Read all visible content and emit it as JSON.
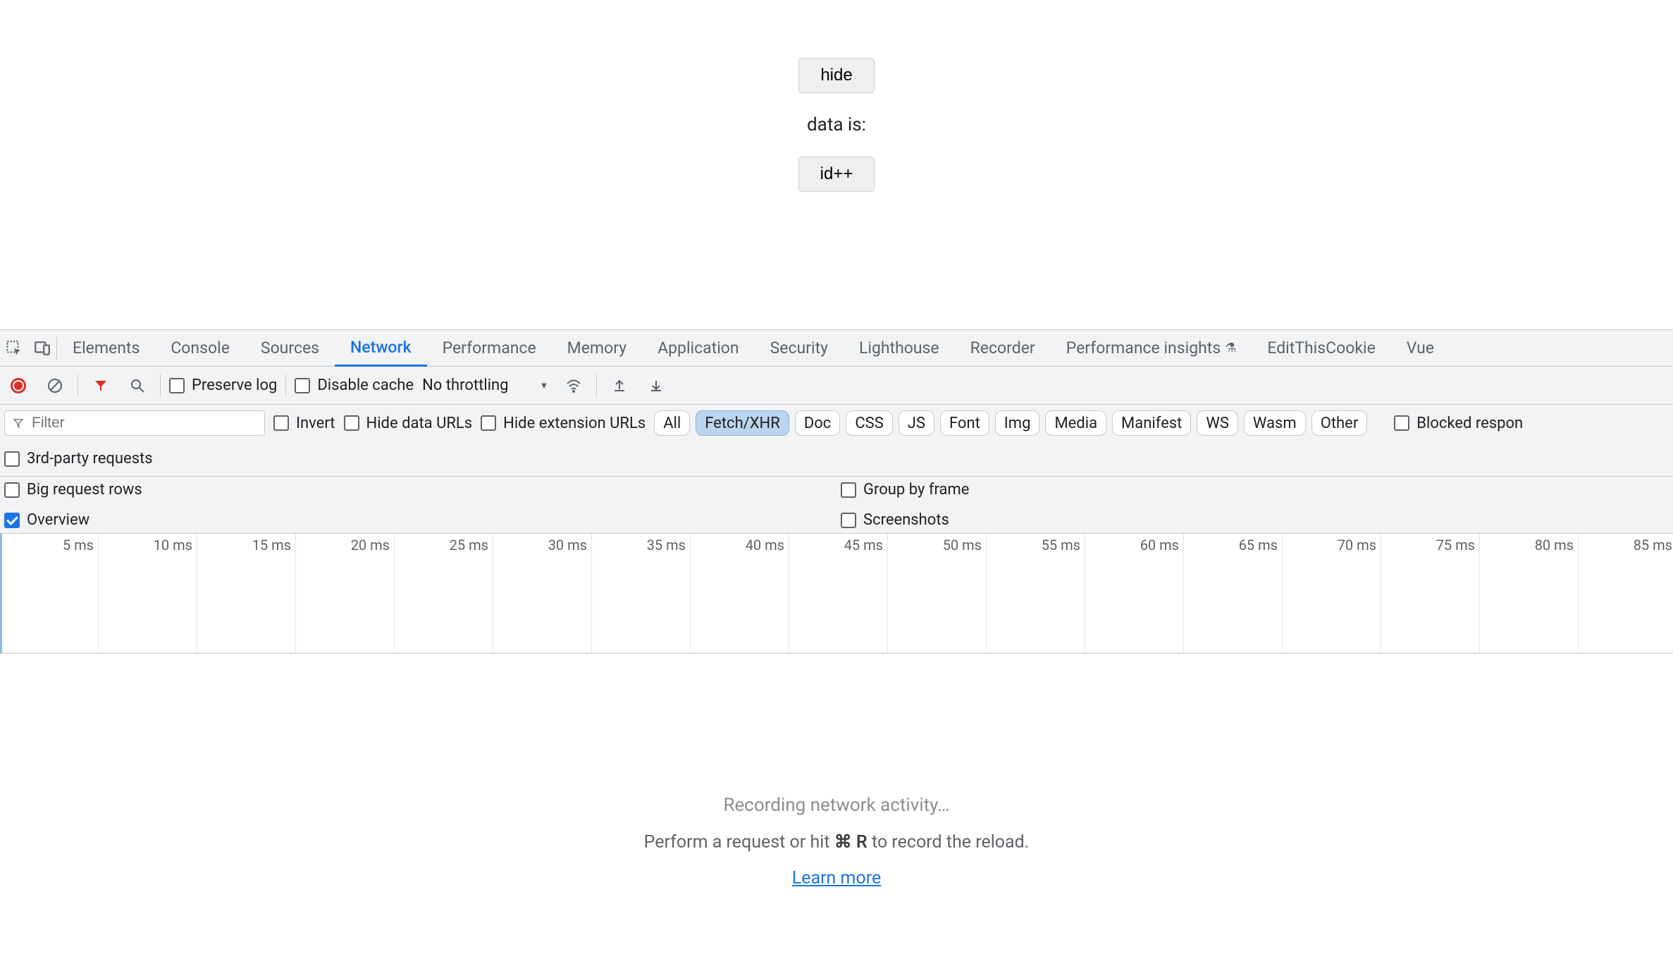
{
  "page_content": {
    "hide_button": "hide",
    "data_text": "data is:",
    "id_button": "id++"
  },
  "tabs": [
    "Elements",
    "Console",
    "Sources",
    "Network",
    "Performance",
    "Memory",
    "Application",
    "Security",
    "Lighthouse",
    "Recorder",
    "Performance insights",
    "EditThisCookie",
    "Vue"
  ],
  "active_tab": "Network",
  "insights_flask": true,
  "toolbar1": {
    "preserve_log": "Preserve log",
    "disable_cache": "Disable cache",
    "throttling": "No throttling"
  },
  "filter": {
    "placeholder": "Filter",
    "invert": "Invert",
    "hide_data_urls": "Hide data URLs",
    "hide_ext_urls": "Hide extension URLs",
    "blocked_respon": "Blocked respon"
  },
  "pills": [
    "All",
    "Fetch/XHR",
    "Doc",
    "CSS",
    "JS",
    "Font",
    "Img",
    "Media",
    "Manifest",
    "WS",
    "Wasm",
    "Other"
  ],
  "active_pill": "Fetch/XHR",
  "third_party": "3rd-party requests",
  "options": {
    "big_rows": "Big request rows",
    "overview": "Overview",
    "group_by_frame": "Group by frame",
    "screenshots": "Screenshots"
  },
  "timeline_ticks": [
    "5 ms",
    "10 ms",
    "15 ms",
    "20 ms",
    "25 ms",
    "30 ms",
    "35 ms",
    "40 ms",
    "45 ms",
    "50 ms",
    "55 ms",
    "60 ms",
    "65 ms",
    "70 ms",
    "75 ms",
    "80 ms",
    "85 ms"
  ],
  "empty": {
    "line1": "Recording network activity…",
    "line2_pre": "Perform a request or hit ",
    "line2_kbd": "⌘ R",
    "line2_post": " to record the reload.",
    "learn": "Learn more"
  }
}
